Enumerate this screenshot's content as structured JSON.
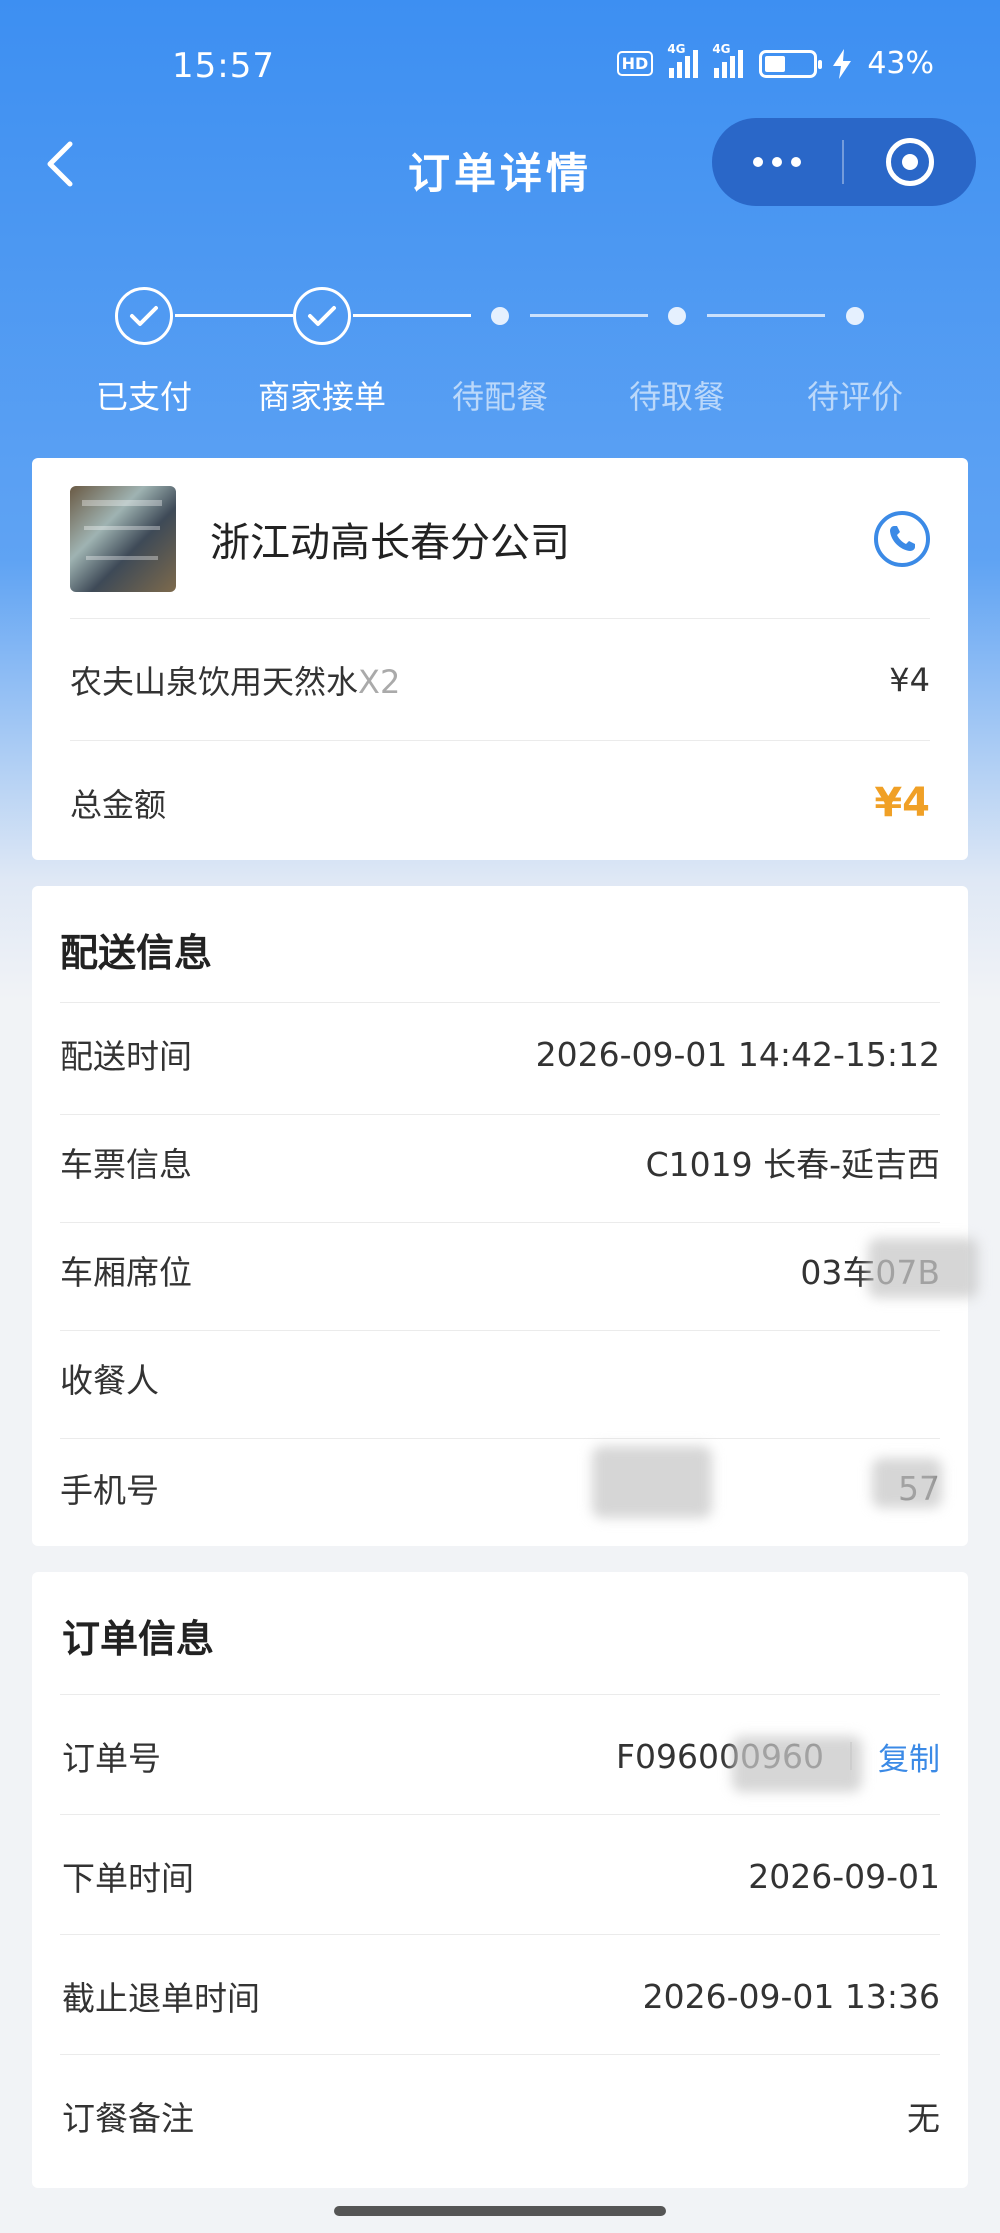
{
  "status_bar": {
    "time": "15:57",
    "hd_badge": "HD",
    "network_1": "4G",
    "network_2": "4G",
    "battery": "43%",
    "battery_level": 0.43
  },
  "nav": {
    "title": "订单详情"
  },
  "progress": {
    "steps": [
      {
        "label": "已支付",
        "done": true
      },
      {
        "label": "商家接单",
        "done": true
      },
      {
        "label": "待配餐",
        "done": false
      },
      {
        "label": "待取餐",
        "done": false
      },
      {
        "label": "待评价",
        "done": false
      }
    ]
  },
  "order_card": {
    "shop_name": "浙江动高长春分公司",
    "item_name": "农夫山泉饮用天然水",
    "item_qty": "X2",
    "item_price": "¥4",
    "total_label": "总金额",
    "total_value": "¥4"
  },
  "delivery": {
    "title": "配送信息",
    "rows": [
      {
        "label": "配送时间",
        "value": "2026-09-01 14:42-15:12"
      },
      {
        "label": "车票信息",
        "value": "C1019 长春-延吉西"
      },
      {
        "label": "车厢席位",
        "value": "03车07B"
      },
      {
        "label": "收餐人",
        "value": ""
      },
      {
        "label": "手机号",
        "value": "57"
      }
    ]
  },
  "order_info": {
    "title": "订单信息",
    "order_no_label": "订单号",
    "order_no_value": "F096000960",
    "copy_label": "复制",
    "rows": [
      {
        "label": "下单时间",
        "value": "2026-09-01"
      },
      {
        "label": "截止退单时间",
        "value": "2026-09-01 13:36"
      },
      {
        "label": "订餐备注",
        "value": "无"
      }
    ]
  },
  "colors": {
    "primary_blue": "#3d8ff2",
    "accent_orange": "#f0a026",
    "link_blue": "#3b8ae6"
  }
}
